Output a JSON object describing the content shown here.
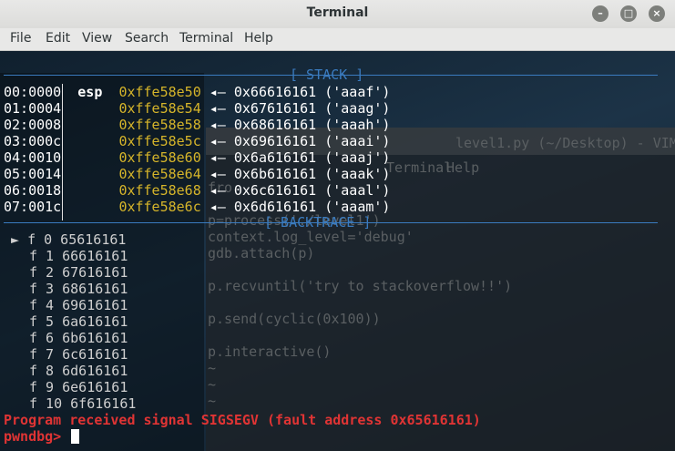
{
  "window": {
    "title": "Terminal"
  },
  "menubar": [
    "File",
    "Edit",
    "View",
    "Search",
    "Terminal",
    "Help"
  ],
  "stack": {
    "header": "[ STACK ]",
    "reg": "esp",
    "rows": [
      {
        "off": "00:0000",
        "addr": "0xffe58e50",
        "arrow": "◂—",
        "val": "0x66616161 ('aaaf')"
      },
      {
        "off": "01:0004",
        "addr": "0xffe58e54",
        "arrow": "◂—",
        "val": "0x67616161 ('aaag')"
      },
      {
        "off": "02:0008",
        "addr": "0xffe58e58",
        "arrow": "◂—",
        "val": "0x68616161 ('aaah')"
      },
      {
        "off": "03:000c",
        "addr": "0xffe58e5c",
        "arrow": "◂—",
        "val": "0x69616161 ('aaai')"
      },
      {
        "off": "04:0010",
        "addr": "0xffe58e60",
        "arrow": "◂—",
        "val": "0x6a616161 ('aaaj')"
      },
      {
        "off": "05:0014",
        "addr": "0xffe58e64",
        "arrow": "◂—",
        "val": "0x6b616161 ('aaak')"
      },
      {
        "off": "06:0018",
        "addr": "0xffe58e68",
        "arrow": "◂—",
        "val": "0x6c616161 ('aaal')"
      },
      {
        "off": "07:001c",
        "addr": "0xffe58e6c",
        "arrow": "◂—",
        "val": "0x6d616161 ('aaam')"
      }
    ]
  },
  "backtrace": {
    "header": "[ BACKTRACE ]",
    "marker": "►",
    "frames": [
      "f 0 65616161",
      "f 1 66616161",
      "f 2 67616161",
      "f 3 68616161",
      "f 4 69616161",
      "f 5 6a616161",
      "f 6 6b616161",
      "f 7 6c616161",
      "f 8 6d616161",
      "f 9 6e616161",
      "f 10 6f616161"
    ]
  },
  "signal_msg": "Program received signal SIGSEGV (fault address 0x65616161)",
  "prompt": "pwndbg>",
  "vim_bg": {
    "title": "level1.py (~/Desktop) - VIM",
    "menu": [
      "Terminal",
      "Help"
    ],
    "lines": [
      "fro",
      "p=process('./level1')",
      "context.log_level='debug'",
      "gdb.attach(p)",
      "",
      "p.recvuntil('try to stackoverflow!!')",
      "",
      "p.send(cyclic(0x100))",
      "",
      "p.interactive()",
      "~",
      "~",
      "~"
    ]
  },
  "colors": {
    "accent": "#3a7bbf",
    "address": "#d6b52a",
    "error": "#e03434",
    "prompt": "#e03434"
  }
}
